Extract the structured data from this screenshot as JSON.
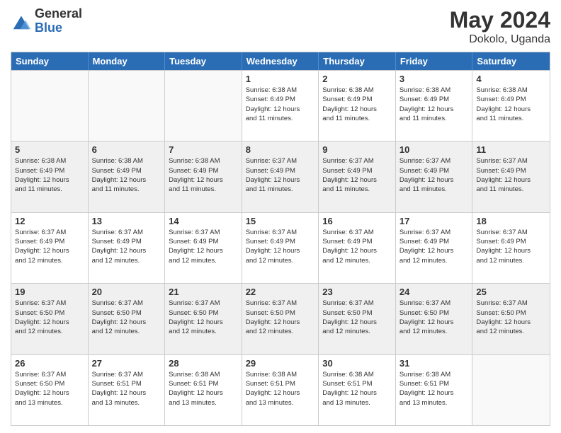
{
  "header": {
    "logo_general": "General",
    "logo_blue": "Blue",
    "month_year": "May 2024",
    "location": "Dokolo, Uganda"
  },
  "days_of_week": [
    "Sunday",
    "Monday",
    "Tuesday",
    "Wednesday",
    "Thursday",
    "Friday",
    "Saturday"
  ],
  "weeks": [
    [
      {
        "day": "",
        "info": "",
        "empty": true
      },
      {
        "day": "",
        "info": "",
        "empty": true
      },
      {
        "day": "",
        "info": "",
        "empty": true
      },
      {
        "day": "1",
        "info": "Sunrise: 6:38 AM\nSunset: 6:49 PM\nDaylight: 12 hours\nand 11 minutes."
      },
      {
        "day": "2",
        "info": "Sunrise: 6:38 AM\nSunset: 6:49 PM\nDaylight: 12 hours\nand 11 minutes."
      },
      {
        "day": "3",
        "info": "Sunrise: 6:38 AM\nSunset: 6:49 PM\nDaylight: 12 hours\nand 11 minutes."
      },
      {
        "day": "4",
        "info": "Sunrise: 6:38 AM\nSunset: 6:49 PM\nDaylight: 12 hours\nand 11 minutes."
      }
    ],
    [
      {
        "day": "5",
        "info": "Sunrise: 6:38 AM\nSunset: 6:49 PM\nDaylight: 12 hours\nand 11 minutes."
      },
      {
        "day": "6",
        "info": "Sunrise: 6:38 AM\nSunset: 6:49 PM\nDaylight: 12 hours\nand 11 minutes."
      },
      {
        "day": "7",
        "info": "Sunrise: 6:38 AM\nSunset: 6:49 PM\nDaylight: 12 hours\nand 11 minutes."
      },
      {
        "day": "8",
        "info": "Sunrise: 6:37 AM\nSunset: 6:49 PM\nDaylight: 12 hours\nand 11 minutes."
      },
      {
        "day": "9",
        "info": "Sunrise: 6:37 AM\nSunset: 6:49 PM\nDaylight: 12 hours\nand 11 minutes."
      },
      {
        "day": "10",
        "info": "Sunrise: 6:37 AM\nSunset: 6:49 PM\nDaylight: 12 hours\nand 11 minutes."
      },
      {
        "day": "11",
        "info": "Sunrise: 6:37 AM\nSunset: 6:49 PM\nDaylight: 12 hours\nand 11 minutes."
      }
    ],
    [
      {
        "day": "12",
        "info": "Sunrise: 6:37 AM\nSunset: 6:49 PM\nDaylight: 12 hours\nand 12 minutes."
      },
      {
        "day": "13",
        "info": "Sunrise: 6:37 AM\nSunset: 6:49 PM\nDaylight: 12 hours\nand 12 minutes."
      },
      {
        "day": "14",
        "info": "Sunrise: 6:37 AM\nSunset: 6:49 PM\nDaylight: 12 hours\nand 12 minutes."
      },
      {
        "day": "15",
        "info": "Sunrise: 6:37 AM\nSunset: 6:49 PM\nDaylight: 12 hours\nand 12 minutes."
      },
      {
        "day": "16",
        "info": "Sunrise: 6:37 AM\nSunset: 6:49 PM\nDaylight: 12 hours\nand 12 minutes."
      },
      {
        "day": "17",
        "info": "Sunrise: 6:37 AM\nSunset: 6:49 PM\nDaylight: 12 hours\nand 12 minutes."
      },
      {
        "day": "18",
        "info": "Sunrise: 6:37 AM\nSunset: 6:49 PM\nDaylight: 12 hours\nand 12 minutes."
      }
    ],
    [
      {
        "day": "19",
        "info": "Sunrise: 6:37 AM\nSunset: 6:50 PM\nDaylight: 12 hours\nand 12 minutes."
      },
      {
        "day": "20",
        "info": "Sunrise: 6:37 AM\nSunset: 6:50 PM\nDaylight: 12 hours\nand 12 minutes."
      },
      {
        "day": "21",
        "info": "Sunrise: 6:37 AM\nSunset: 6:50 PM\nDaylight: 12 hours\nand 12 minutes."
      },
      {
        "day": "22",
        "info": "Sunrise: 6:37 AM\nSunset: 6:50 PM\nDaylight: 12 hours\nand 12 minutes."
      },
      {
        "day": "23",
        "info": "Sunrise: 6:37 AM\nSunset: 6:50 PM\nDaylight: 12 hours\nand 12 minutes."
      },
      {
        "day": "24",
        "info": "Sunrise: 6:37 AM\nSunset: 6:50 PM\nDaylight: 12 hours\nand 12 minutes."
      },
      {
        "day": "25",
        "info": "Sunrise: 6:37 AM\nSunset: 6:50 PM\nDaylight: 12 hours\nand 12 minutes."
      }
    ],
    [
      {
        "day": "26",
        "info": "Sunrise: 6:37 AM\nSunset: 6:50 PM\nDaylight: 12 hours\nand 13 minutes."
      },
      {
        "day": "27",
        "info": "Sunrise: 6:37 AM\nSunset: 6:51 PM\nDaylight: 12 hours\nand 13 minutes."
      },
      {
        "day": "28",
        "info": "Sunrise: 6:38 AM\nSunset: 6:51 PM\nDaylight: 12 hours\nand 13 minutes."
      },
      {
        "day": "29",
        "info": "Sunrise: 6:38 AM\nSunset: 6:51 PM\nDaylight: 12 hours\nand 13 minutes."
      },
      {
        "day": "30",
        "info": "Sunrise: 6:38 AM\nSunset: 6:51 PM\nDaylight: 12 hours\nand 13 minutes."
      },
      {
        "day": "31",
        "info": "Sunrise: 6:38 AM\nSunset: 6:51 PM\nDaylight: 12 hours\nand 13 minutes."
      },
      {
        "day": "",
        "info": "",
        "empty": true
      }
    ]
  ]
}
